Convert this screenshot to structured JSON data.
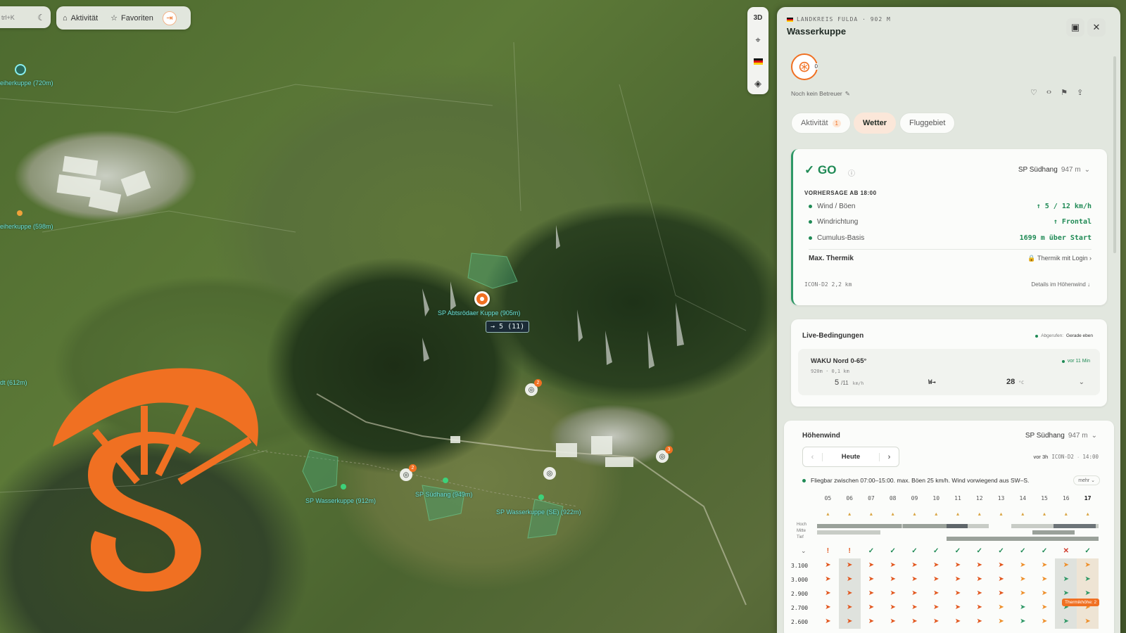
{
  "toolbar": {
    "search_hint": "trl+K",
    "activity_label": "Aktivität",
    "favorites_label": "Favoriten"
  },
  "map_controls": {
    "view3d": "3D"
  },
  "map": {
    "pins": [
      {
        "label": "eiherkuppe (720m)"
      },
      {
        "label": "eiherkuppe (598m)"
      },
      {
        "label": "SP Abtsrödaer Kuppe (905m)"
      },
      {
        "label": "dt (612m)"
      },
      {
        "label": "SP Wasserkuppe (912m)"
      },
      {
        "label": "SP Südhang (949m)"
      },
      {
        "label": "SP Wasserkuppe (SE) (922m)"
      }
    ],
    "wind_badge": "→ 5 (11)",
    "photo_counts": [
      "2",
      "2",
      "3"
    ]
  },
  "panel": {
    "region": "LANDKREIS FULDA · 902 M",
    "title": "Wasserkuppe",
    "avatar_count": "0",
    "caretaker": "Noch kein Betreuer",
    "tabs": [
      {
        "label": "Aktivität",
        "badge": "1"
      },
      {
        "label": "Wetter"
      },
      {
        "label": "Fluggebiet"
      }
    ],
    "go": {
      "status": "✓ GO",
      "site_name": "SP Südhang",
      "site_alt": "947 m",
      "forecast_header": "VORHERSAGE AB 18:00",
      "rows": [
        {
          "label": "Wind / Böen",
          "value": "↑ 5 / 12 km/h"
        },
        {
          "label": "Windrichtung",
          "value": "↑ Frontal"
        },
        {
          "label": "Cumulus-Basis",
          "value": "1699 m über Start"
        }
      ],
      "thermal_label": "Max. Thermik",
      "thermal_value": "Thermik mit Login",
      "model": "ICON-D2 2,2 km",
      "details_link": "Details im Höhenwind ↓"
    },
    "live": {
      "title": "Live-Bedingungen",
      "fetched_label": "Abgerufen:",
      "fetched_value": "Gerade eben",
      "station": "WAKU Nord 0-65°",
      "station_meta": "920m · 0,1 km",
      "age": "vor 11 Min",
      "wind": "5",
      "gust": "/11",
      "wind_unit": "km/h",
      "dir": "W→",
      "temp": "28",
      "temp_unit": "°C"
    },
    "hoehenwind": {
      "title": "Höhenwind",
      "site_name": "SP Südhang",
      "site_alt": "947 m",
      "day": "Heute",
      "updated": "vor 3h",
      "model": "ICON-D2",
      "time": "14:00",
      "summary": "Fliegbar zwischen 07:00–15:00. max. Böen 25 km/h. Wind vorwiegend aus SW–S.",
      "more": "mehr",
      "hours": [
        "05",
        "06",
        "07",
        "08",
        "09",
        "10",
        "11",
        "12",
        "13",
        "14",
        "15",
        "16",
        "17"
      ],
      "cloud_labels": [
        "Hoch",
        "Mitte",
        "Tief"
      ],
      "status_row": [
        "!",
        "!",
        "✓",
        "✓",
        "✓",
        "✓",
        "✓",
        "✓",
        "✓",
        "✓",
        "✓",
        "✕",
        "✓"
      ],
      "altitudes": [
        "3.100",
        "3.000",
        "2.900",
        "2.700",
        "2.600"
      ],
      "thermal_tag": "Thermikhöhe: 2"
    }
  }
}
